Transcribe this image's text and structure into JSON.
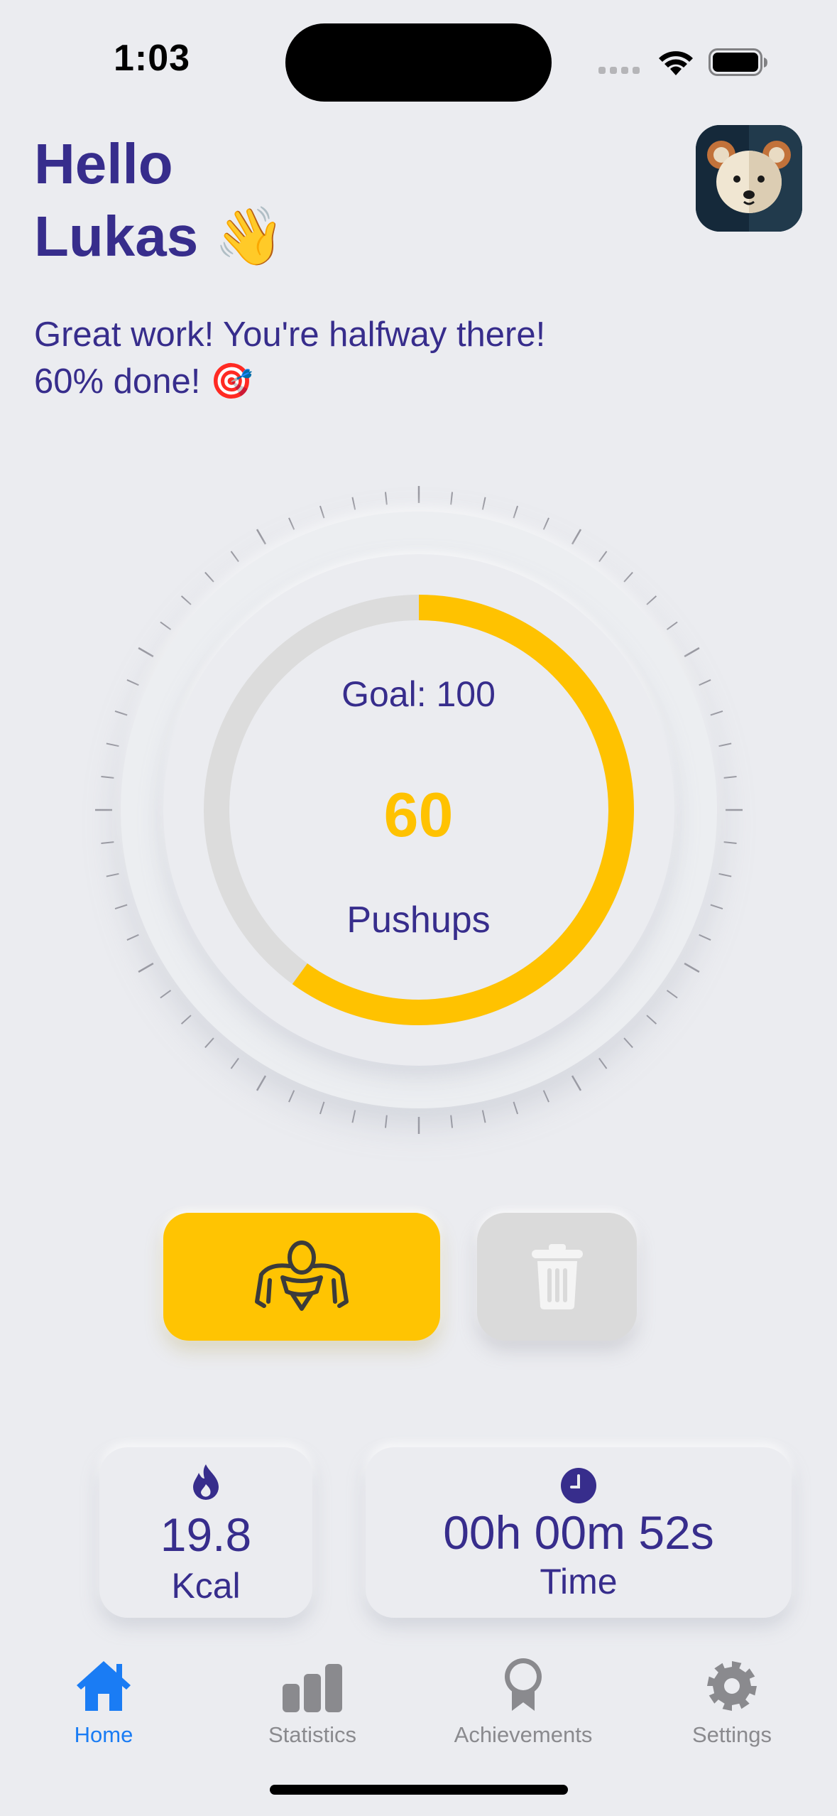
{
  "status_bar": {
    "time": "1:03"
  },
  "greeting": {
    "line1": "Hello",
    "line2": "Lukas 👋"
  },
  "motivation": {
    "line1": "Great work! You're halfway there!",
    "line2": "60% done! 🎯"
  },
  "counter": {
    "goal_label": "Goal: 100",
    "count": "60",
    "unit": "Pushups",
    "progress": 0.6,
    "progress_color": "#ffc200",
    "track_color": "#dcdcdc"
  },
  "actions": {
    "pushup_icon": "pushup-person-icon",
    "delete_icon": "trash-icon",
    "pushup_color": "#ffc402",
    "delete_color": "#dadada"
  },
  "stats": {
    "kcal": {
      "icon": "flame-icon",
      "value": "19.8",
      "label": "Kcal"
    },
    "time": {
      "icon": "clock-icon",
      "value": "00h 00m 52s",
      "label": "Time"
    }
  },
  "tab_bar": {
    "tabs": [
      {
        "label": "Home",
        "icon": "house-icon",
        "active": true
      },
      {
        "label": "Statistics",
        "icon": "bar-chart-icon",
        "active": false
      },
      {
        "label": "Achievements",
        "icon": "ribbon-icon",
        "active": false
      },
      {
        "label": "Settings",
        "icon": "gear-icon",
        "active": false
      }
    ],
    "active_color": "#1a7cf4",
    "inactive_color": "#8a8a8e"
  },
  "theme": {
    "text_color": "#372d8c",
    "background": "#ebecf0"
  }
}
